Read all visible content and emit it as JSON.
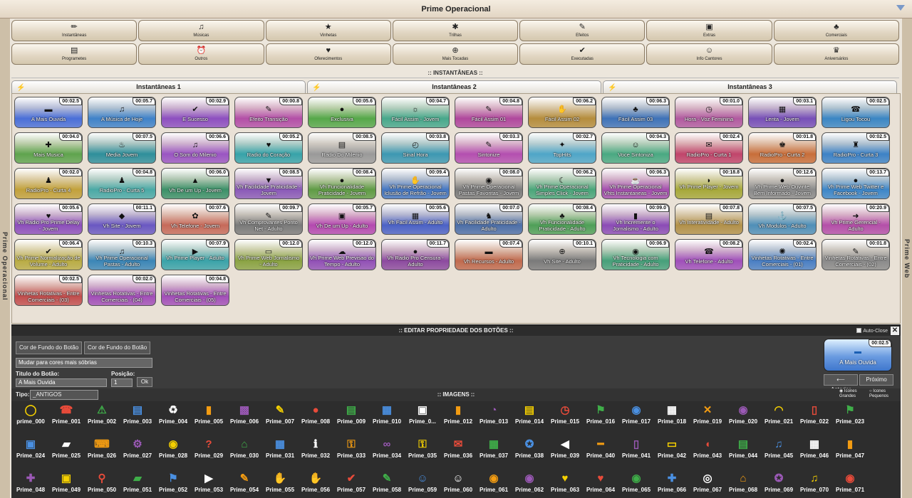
{
  "window": {
    "title": "Prime Operacional",
    "left_label": "Prime Operacional",
    "right_label": "Prime Web"
  },
  "categories_row1": [
    {
      "label": "Instantâneas",
      "icon": "✏"
    },
    {
      "label": "Músicas",
      "icon": "♫"
    },
    {
      "label": "Vinhetas",
      "icon": "★"
    },
    {
      "label": "Trilhas",
      "icon": "✱"
    },
    {
      "label": "Efeitos",
      "icon": "✎"
    },
    {
      "label": "Extras",
      "icon": "▣"
    },
    {
      "label": "Comerciais",
      "icon": "♣"
    }
  ],
  "categories_row2": [
    {
      "label": "Programetes",
      "icon": "▤"
    },
    {
      "label": "Outros",
      "icon": "⏰"
    },
    {
      "label": "Oferecimentos",
      "icon": "♥"
    },
    {
      "label": "Mais Tocadas",
      "icon": "⊕"
    },
    {
      "label": "Executadas",
      "icon": "✔"
    },
    {
      "label": "Info Cantores",
      "icon": "☺"
    },
    {
      "label": "Aniversários",
      "icon": "♛"
    }
  ],
  "section_title": ":: INSTANTÂNEAS ::",
  "tabs": [
    "Instantâneas 1",
    "Instantâneas 2",
    "Instantâneas 3"
  ],
  "buttons": [
    {
      "label": "A Mais Ouvida",
      "time": "00:02.5",
      "color": "#4a6fd8",
      "icon": "▬"
    },
    {
      "label": "A Música de Hoje",
      "time": "00:05.7",
      "color": "#3f82c9",
      "icon": "♫"
    },
    {
      "label": "E Sucesso",
      "time": "00:02.9",
      "color": "#8d4fc0",
      "icon": "✔"
    },
    {
      "label": "Efeito Transição",
      "time": "00:00.8",
      "color": "#b34fa7",
      "icon": "✎"
    },
    {
      "label": "Exclusiva",
      "time": "00:05.6",
      "color": "#56a84a",
      "icon": "●"
    },
    {
      "label": "Fácil Assim - Jovem",
      "time": "00:04.7",
      "color": "#47a88b",
      "icon": "☼"
    },
    {
      "label": "Fácil Assim 01",
      "time": "00:04.8",
      "color": "#b0489d",
      "icon": "✎"
    },
    {
      "label": "Fácil Assim 02",
      "time": "00:06.2",
      "color": "#b58d3d",
      "icon": "✋"
    },
    {
      "label": "Fácil Assim 03",
      "time": "00:06.3",
      "color": "#3e72b8",
      "icon": "♣"
    },
    {
      "label": "Hora - Voz Feminina",
      "time": "00:01.0",
      "color": "#b15aa0",
      "icon": "◷"
    },
    {
      "label": "Lenta - Jovem",
      "time": "00:03.1",
      "color": "#7750b8",
      "icon": "▦"
    },
    {
      "label": "Ligou Tocou",
      "time": "00:02.5",
      "color": "#3b86c4",
      "icon": "☎"
    },
    {
      "label": "Mais Musica",
      "time": "00:04.0",
      "color": "#5fa44e",
      "icon": "✚"
    },
    {
      "label": "Media Jovem",
      "time": "00:07.5",
      "color": "#2f8f9b",
      "icon": "♨"
    },
    {
      "label": "O Som do Milenio",
      "time": "00:06.6",
      "color": "#9a55c2",
      "icon": "♫"
    },
    {
      "label": "Radio do Coração",
      "time": "00:05.2",
      "color": "#37a3a9",
      "icon": "♥"
    },
    {
      "label": "Radio Do Milenio",
      "time": "00:08.5",
      "color": "#9a9a9a",
      "icon": "▤"
    },
    {
      "label": "Sinal Hora",
      "time": "00:03.8",
      "color": "#3d98b2",
      "icon": "◴"
    },
    {
      "label": "Sintonize",
      "time": "00:03.3",
      "color": "#b44fb0",
      "icon": "✎"
    },
    {
      "label": "TopHits",
      "time": "00:02.7",
      "color": "#4fa6c8",
      "icon": "✦"
    },
    {
      "label": "Voce Sintoniza",
      "time": "00:04.3",
      "color": "#4aa982",
      "icon": "☺"
    },
    {
      "label": "RadioPro - Curta 1",
      "time": "00:02.4",
      "color": "#c0456b",
      "icon": "✉"
    },
    {
      "label": "RadioPro - Curta 2",
      "time": "00:01.8",
      "color": "#c86e3a",
      "icon": "♚"
    },
    {
      "label": "RadioPro - Curta 3",
      "time": "00:02.5",
      "color": "#3d82c6",
      "icon": "♜"
    },
    {
      "label": "RadioPro - Curta 4",
      "time": "00:02.0",
      "color": "#c2a13b",
      "icon": "♟"
    },
    {
      "label": "RadioPro - Curta 5",
      "time": "00:04.8",
      "color": "#4aa9a6",
      "icon": "♟"
    },
    {
      "label": "Vh De um Up - Jovem",
      "time": "00:06.0",
      "color": "#3b9068",
      "icon": "▲"
    },
    {
      "label": "Vh Facilidade Praticidade - Jovem",
      "time": "00:08.5",
      "color": "#8a5ab8",
      "icon": "▼"
    },
    {
      "label": "Vh Funcionalidade Praticidade - Jovem",
      "time": "00:08.4",
      "color": "#5f9b45",
      "icon": "●"
    },
    {
      "label": "Vh Prime Operacional Iclusão de Refrão - Jovem",
      "time": "00:09.4",
      "color": "#4577c2",
      "icon": "✋"
    },
    {
      "label": "Vh Prime Operacional Pastas Favoritas - Jovem",
      "time": "00:08.0",
      "color": "#7c7c7c",
      "icon": "◉"
    },
    {
      "label": "Vh Prime Operacional Simples Click - Jovem",
      "time": "00:06.2",
      "color": "#4aa67a",
      "icon": "☾"
    },
    {
      "label": "Vh Prime Operacional Vhts Instantaneas - Jovem",
      "time": "00:06.3",
      "color": "#a44fae",
      "icon": "☕"
    },
    {
      "label": "Vh Prime Player - Jovem",
      "time": "00:18.8",
      "color": "#a6a83a",
      "icon": "◗"
    },
    {
      "label": "Vh Prime Web Ouvinte Bem Informado - Jovem",
      "time": "00:12.6",
      "color": "#8a8a8a",
      "icon": "●"
    },
    {
      "label": "Vh Prime Web Twitter e Facebook - Jovem",
      "time": "00:13.7",
      "color": "#3d86c8",
      "icon": "●"
    },
    {
      "label": "Vh Radio Pro Prime Delay - Jovem",
      "time": "00:05.6",
      "color": "#8d4fbc",
      "icon": "♥"
    },
    {
      "label": "Vh Site - Jovem",
      "time": "00:11.1",
      "color": "#6a58c2",
      "icon": "◆"
    },
    {
      "label": "Vh Telefone - Jovem",
      "time": "00:07.6",
      "color": "#c66a5a",
      "icon": "✿"
    },
    {
      "label": "Vh Comprovantes Ponto Net - Adulto",
      "time": "00:09.7",
      "color": "#7a7a7a",
      "icon": "✎"
    },
    {
      "label": "Vh De um Up - Adulto",
      "time": "00:05.7",
      "color": "#b449b0",
      "icon": "▣"
    },
    {
      "label": "Vh Facil Assim - Adulto",
      "time": "00:05.6",
      "color": "#4b62c6",
      "icon": "▦"
    },
    {
      "label": "Vh Facilidade Praticidade - Adulto",
      "time": "00:07.0",
      "color": "#4d6fa8",
      "icon": "♞"
    },
    {
      "label": "Vh Funcionalidade Praticidade - Adulto",
      "time": "00:08.4",
      "color": "#4f9f58",
      "icon": "♣"
    },
    {
      "label": "Vh Incremente o Jornalismo - Adulto",
      "time": "00:09.0",
      "color": "#8b4cb6",
      "icon": "▮"
    },
    {
      "label": "Vh Interatividade - Adulto",
      "time": "00:07.8",
      "color": "#b2914a",
      "icon": "▤"
    },
    {
      "label": "Vh Modulos - Adulto",
      "time": "00:07.5",
      "color": "#4f8fb8",
      "icon": "⚓"
    },
    {
      "label": "Vh Prime Gerencial - Adulto",
      "time": "00:20.9",
      "color": "#b44fa9",
      "icon": "➜"
    },
    {
      "label": "Vh Prime Normalização de Volume - Adulto",
      "time": "00:06.4",
      "color": "#b9ac45",
      "icon": "✔"
    },
    {
      "label": "Vh Prime Operacional Pastas - Adulto",
      "time": "00:10.3",
      "color": "#3b86b7",
      "icon": "♫"
    },
    {
      "label": "Vh Prime Player - Adulto",
      "time": "00:07.9",
      "color": "#3aa3a9",
      "icon": "▶"
    },
    {
      "label": "Vh Prime Web Jornalismo - Adulto",
      "time": "00:12.0",
      "color": "#8aa343",
      "icon": "▭"
    },
    {
      "label": "Vh Prime Web Previsao do Tempo - Adulto",
      "time": "00:12.0",
      "color": "#9150b6",
      "icon": "☁"
    },
    {
      "label": "Vh Radio Pro Censura - Adulto",
      "time": "00:11.7",
      "color": "#8c4a9f",
      "icon": "●"
    },
    {
      "label": "Vh Recursos - Adulto",
      "time": "00:07.4",
      "color": "#c06a4e",
      "icon": "▬"
    },
    {
      "label": "Vh Site - Adulto",
      "time": "00:10.1",
      "color": "#7a7a7a",
      "icon": "⊕"
    },
    {
      "label": "Vh Tecnologia com Praticidade - Adulto",
      "time": "00:06.9",
      "color": "#46a07a",
      "icon": "◉"
    },
    {
      "label": "Vh Telefone - Adulto",
      "time": "00:08.2",
      "color": "#9f4fba",
      "icon": "☎"
    },
    {
      "label": "Vinhetas Rotativas - Entre Comerciais - (01)",
      "time": "00:02.4",
      "color": "#4a7fc4",
      "icon": "✺"
    },
    {
      "label": "Vinhetas Rotativas - Entre Comerciais - (02)",
      "time": "00:01.8",
      "color": "#8a8a8a",
      "icon": "✎"
    },
    {
      "label": "Vinhetas Rotativas - Entre Comerciais - (03)",
      "time": "00:02.5",
      "color": "#c24e4e",
      "icon": ""
    },
    {
      "label": "Vinhetas Rotativas - Entre Comerciais - (04)",
      "time": "00:02.0",
      "color": "#a24fb8",
      "icon": ""
    },
    {
      "label": "Vinhetas Rotativas - Entre Comerciais - (05)",
      "time": "00:04.8",
      "color": "#a24fb8",
      "icon": ""
    }
  ],
  "editor": {
    "title": ":: EDITAR PROPRIEDADE DOS BOTÕES ::",
    "auto_close": "Auto-Close",
    "bg_color_btn1": "Cor de Fundo do Botão",
    "bg_color_btn2": "Cor de Fundo do Botão",
    "theme_select": "Mudar para cores mais sóbrias",
    "title_label": "Titulo do Botão:",
    "title_value": "A Mais Ouvida",
    "pos_label": "Posição:",
    "pos_value": "1",
    "ok": "Ok",
    "preview_label": "A Mais Ouvida",
    "preview_time": "00:02.5",
    "prev_btn": "Anterior",
    "next_btn": "Próximo"
  },
  "images_bar": {
    "type_label": "Tipo:",
    "type_value": "_ANTIGOS",
    "title": ":: IMAGENS ::",
    "opt_large": "Icones Grandes",
    "opt_small": "Icones Pequenos"
  },
  "images": [
    {
      "label": "prime_000",
      "icon": "◯"
    },
    {
      "label": "Prime_001",
      "icon": "☎"
    },
    {
      "label": "Prime_002",
      "icon": "⚠"
    },
    {
      "label": "Prime_003",
      "icon": "▤"
    },
    {
      "label": "Prime_004",
      "icon": "♻"
    },
    {
      "label": "Prime_005",
      "icon": "▮"
    },
    {
      "label": "Prime_006",
      "icon": "▩"
    },
    {
      "label": "Prime_007",
      "icon": "✎"
    },
    {
      "label": "Prime_008",
      "icon": "●"
    },
    {
      "label": "Prime_009",
      "icon": "▤"
    },
    {
      "label": "Prime_010",
      "icon": "▦"
    },
    {
      "label": "Prime_0...",
      "icon": "▣"
    },
    {
      "label": "Prime_012",
      "icon": "▮"
    },
    {
      "label": "Prime_013",
      "icon": "◔"
    },
    {
      "label": "Prime_014",
      "icon": "▤"
    },
    {
      "label": "Prime_015",
      "icon": "◷"
    },
    {
      "label": "Prime_016",
      "icon": "⚑"
    },
    {
      "label": "Prime_017",
      "icon": "◉"
    },
    {
      "label": "Prime_018",
      "icon": "▦"
    },
    {
      "label": "Prime_019",
      "icon": "✕"
    },
    {
      "label": "Prime_020",
      "icon": "◉"
    },
    {
      "label": "Prime_021",
      "icon": "◠"
    },
    {
      "label": "Prime_022",
      "icon": "▯"
    },
    {
      "label": "Prime_023",
      "icon": "⚑"
    },
    {
      "label": "Prime_024",
      "icon": "▣"
    },
    {
      "label": "Prime_025",
      "icon": "▰"
    },
    {
      "label": "Prime_026",
      "icon": "⌨"
    },
    {
      "label": "Prime_027",
      "icon": "⚙"
    },
    {
      "label": "Prime_028",
      "icon": "◉"
    },
    {
      "label": "Prime_029",
      "icon": "?"
    },
    {
      "label": "Prime_030",
      "icon": "⌂"
    },
    {
      "label": "Prime_031",
      "icon": "▦"
    },
    {
      "label": "Prime_032",
      "icon": "ℹ"
    },
    {
      "label": "Prime_033",
      "icon": "⚿"
    },
    {
      "label": "Prime_034",
      "icon": "∞"
    },
    {
      "label": "Prime_035",
      "icon": "⚿"
    },
    {
      "label": "Prime_036",
      "icon": "✉"
    },
    {
      "label": "Prime_037",
      "icon": "▦"
    },
    {
      "label": "Prime_038",
      "icon": "✪"
    },
    {
      "label": "Prime_039",
      "icon": "◀"
    },
    {
      "label": "Prime_040",
      "icon": "━"
    },
    {
      "label": "Prime_041",
      "icon": "▯"
    },
    {
      "label": "Prime_042",
      "icon": "▭"
    },
    {
      "label": "Prime_043",
      "icon": "◖"
    },
    {
      "label": "Prime_044",
      "icon": "▤"
    },
    {
      "label": "Prime_045",
      "icon": "♫"
    },
    {
      "label": "Prime_046",
      "icon": "▦"
    },
    {
      "label": "Prime_047",
      "icon": "▮"
    },
    {
      "label": "Prime_048",
      "icon": "✚"
    },
    {
      "label": "Prime_049",
      "icon": "▣"
    },
    {
      "label": "Prime_050",
      "icon": "⚲"
    },
    {
      "label": "Prime_051",
      "icon": "▰"
    },
    {
      "label": "Prime_052",
      "icon": "⚑"
    },
    {
      "label": "Prime_053",
      "icon": "▶"
    },
    {
      "label": "Prime_054",
      "icon": "✎"
    },
    {
      "label": "Prime_055",
      "icon": "✋"
    },
    {
      "label": "Prime_056",
      "icon": "✋"
    },
    {
      "label": "Prime_057",
      "icon": "✔"
    },
    {
      "label": "Prime_058",
      "icon": "✎"
    },
    {
      "label": "Prime_059",
      "icon": "☺"
    },
    {
      "label": "Prime_060",
      "icon": "☺"
    },
    {
      "label": "Prime_061",
      "icon": "◉"
    },
    {
      "label": "Prime_062",
      "icon": "◉"
    },
    {
      "label": "Prime_063",
      "icon": "♥"
    },
    {
      "label": "Prime_064",
      "icon": "♥"
    },
    {
      "label": "Prime_065",
      "icon": "◉"
    },
    {
      "label": "Prime_066",
      "icon": "✚"
    },
    {
      "label": "Prime_067",
      "icon": "◎"
    },
    {
      "label": "Prime_068",
      "icon": "⌂"
    },
    {
      "label": "Prime_069",
      "icon": "✪"
    },
    {
      "label": "Prime_070",
      "icon": "♫"
    },
    {
      "label": "Prime_071",
      "icon": "◉"
    }
  ]
}
